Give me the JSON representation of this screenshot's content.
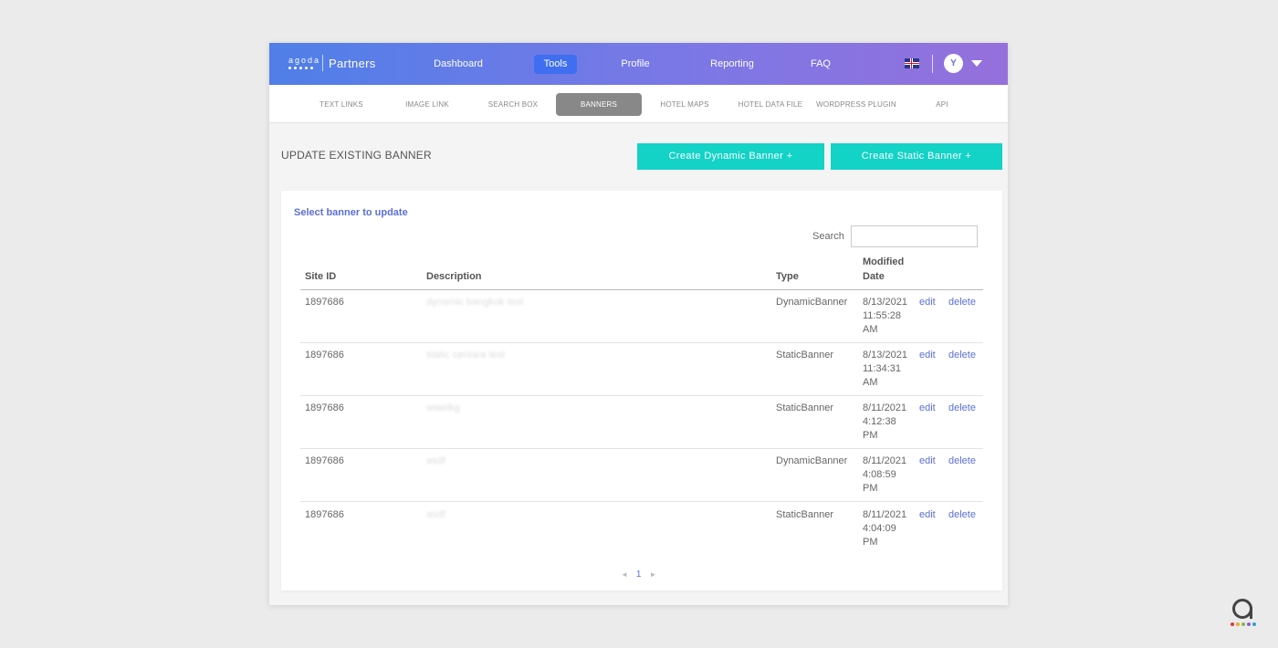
{
  "brand": {
    "logo_word": "agoda",
    "partners": "Partners"
  },
  "topnav": {
    "items": [
      {
        "label": "Dashboard",
        "active": false
      },
      {
        "label": "Tools",
        "active": true
      },
      {
        "label": "Profile",
        "active": false
      },
      {
        "label": "Reporting",
        "active": false
      },
      {
        "label": "FAQ",
        "active": false
      }
    ],
    "avatar_initial": "Y",
    "flag": "uk-flag-icon"
  },
  "subnav": {
    "items": [
      {
        "label": "TEXT LINKS",
        "active": false
      },
      {
        "label": "IMAGE LINK",
        "active": false
      },
      {
        "label": "SEARCH BOX",
        "active": false
      },
      {
        "label": "BANNERS",
        "active": true
      },
      {
        "label": "HOTEL MAPS",
        "active": false
      },
      {
        "label": "HOTEL DATA FILE",
        "active": false
      },
      {
        "label": "WORDPRESS PLUGIN",
        "active": false
      },
      {
        "label": "API",
        "active": false
      }
    ]
  },
  "page": {
    "heading": "UPDATE EXISTING BANNER",
    "create_dynamic": "Create Dynamic Banner +",
    "create_static": "Create Static Banner +"
  },
  "card": {
    "title": "Select banner to update",
    "search_label": "Search",
    "search_value": "",
    "columns": {
      "site_id": "Site ID",
      "description": "Description",
      "type": "Type",
      "modified_line1": "Modified",
      "modified_line2": "Date"
    },
    "rows": [
      {
        "site_id": "1897686",
        "description": "dynamic bangkok test",
        "type": "DynamicBanner",
        "date": "8/13/2021",
        "time": "11:55:28",
        "ampm": "AM",
        "edit": "edit",
        "delete": "delete"
      },
      {
        "site_id": "1897686",
        "description": "static centara test",
        "type": "StaticBanner",
        "date": "8/13/2021",
        "time": "11:34:31",
        "ampm": "AM",
        "edit": "edit",
        "delete": "delete"
      },
      {
        "site_id": "1897686",
        "description": "wiaeikg",
        "type": "StaticBanner",
        "date": "8/11/2021",
        "time": "4:12:38",
        "ampm": "PM",
        "edit": "edit",
        "delete": "delete"
      },
      {
        "site_id": "1897686",
        "description": "asdf",
        "type": "DynamicBanner",
        "date": "8/11/2021",
        "time": "4:08:59",
        "ampm": "PM",
        "edit": "edit",
        "delete": "delete"
      },
      {
        "site_id": "1897686",
        "description": "asdf",
        "type": "StaticBanner",
        "date": "8/11/2021",
        "time": "4:04:09",
        "ampm": "PM",
        "edit": "edit",
        "delete": "delete"
      }
    ],
    "pagination": {
      "prev": "◄",
      "current": "1",
      "next": "►"
    }
  },
  "colors": {
    "accent_teal": "#13d2c6",
    "link_blue": "#5b6fd6",
    "header_gradient_start": "#4f7fe8",
    "header_gradient_end": "#9570dc"
  }
}
